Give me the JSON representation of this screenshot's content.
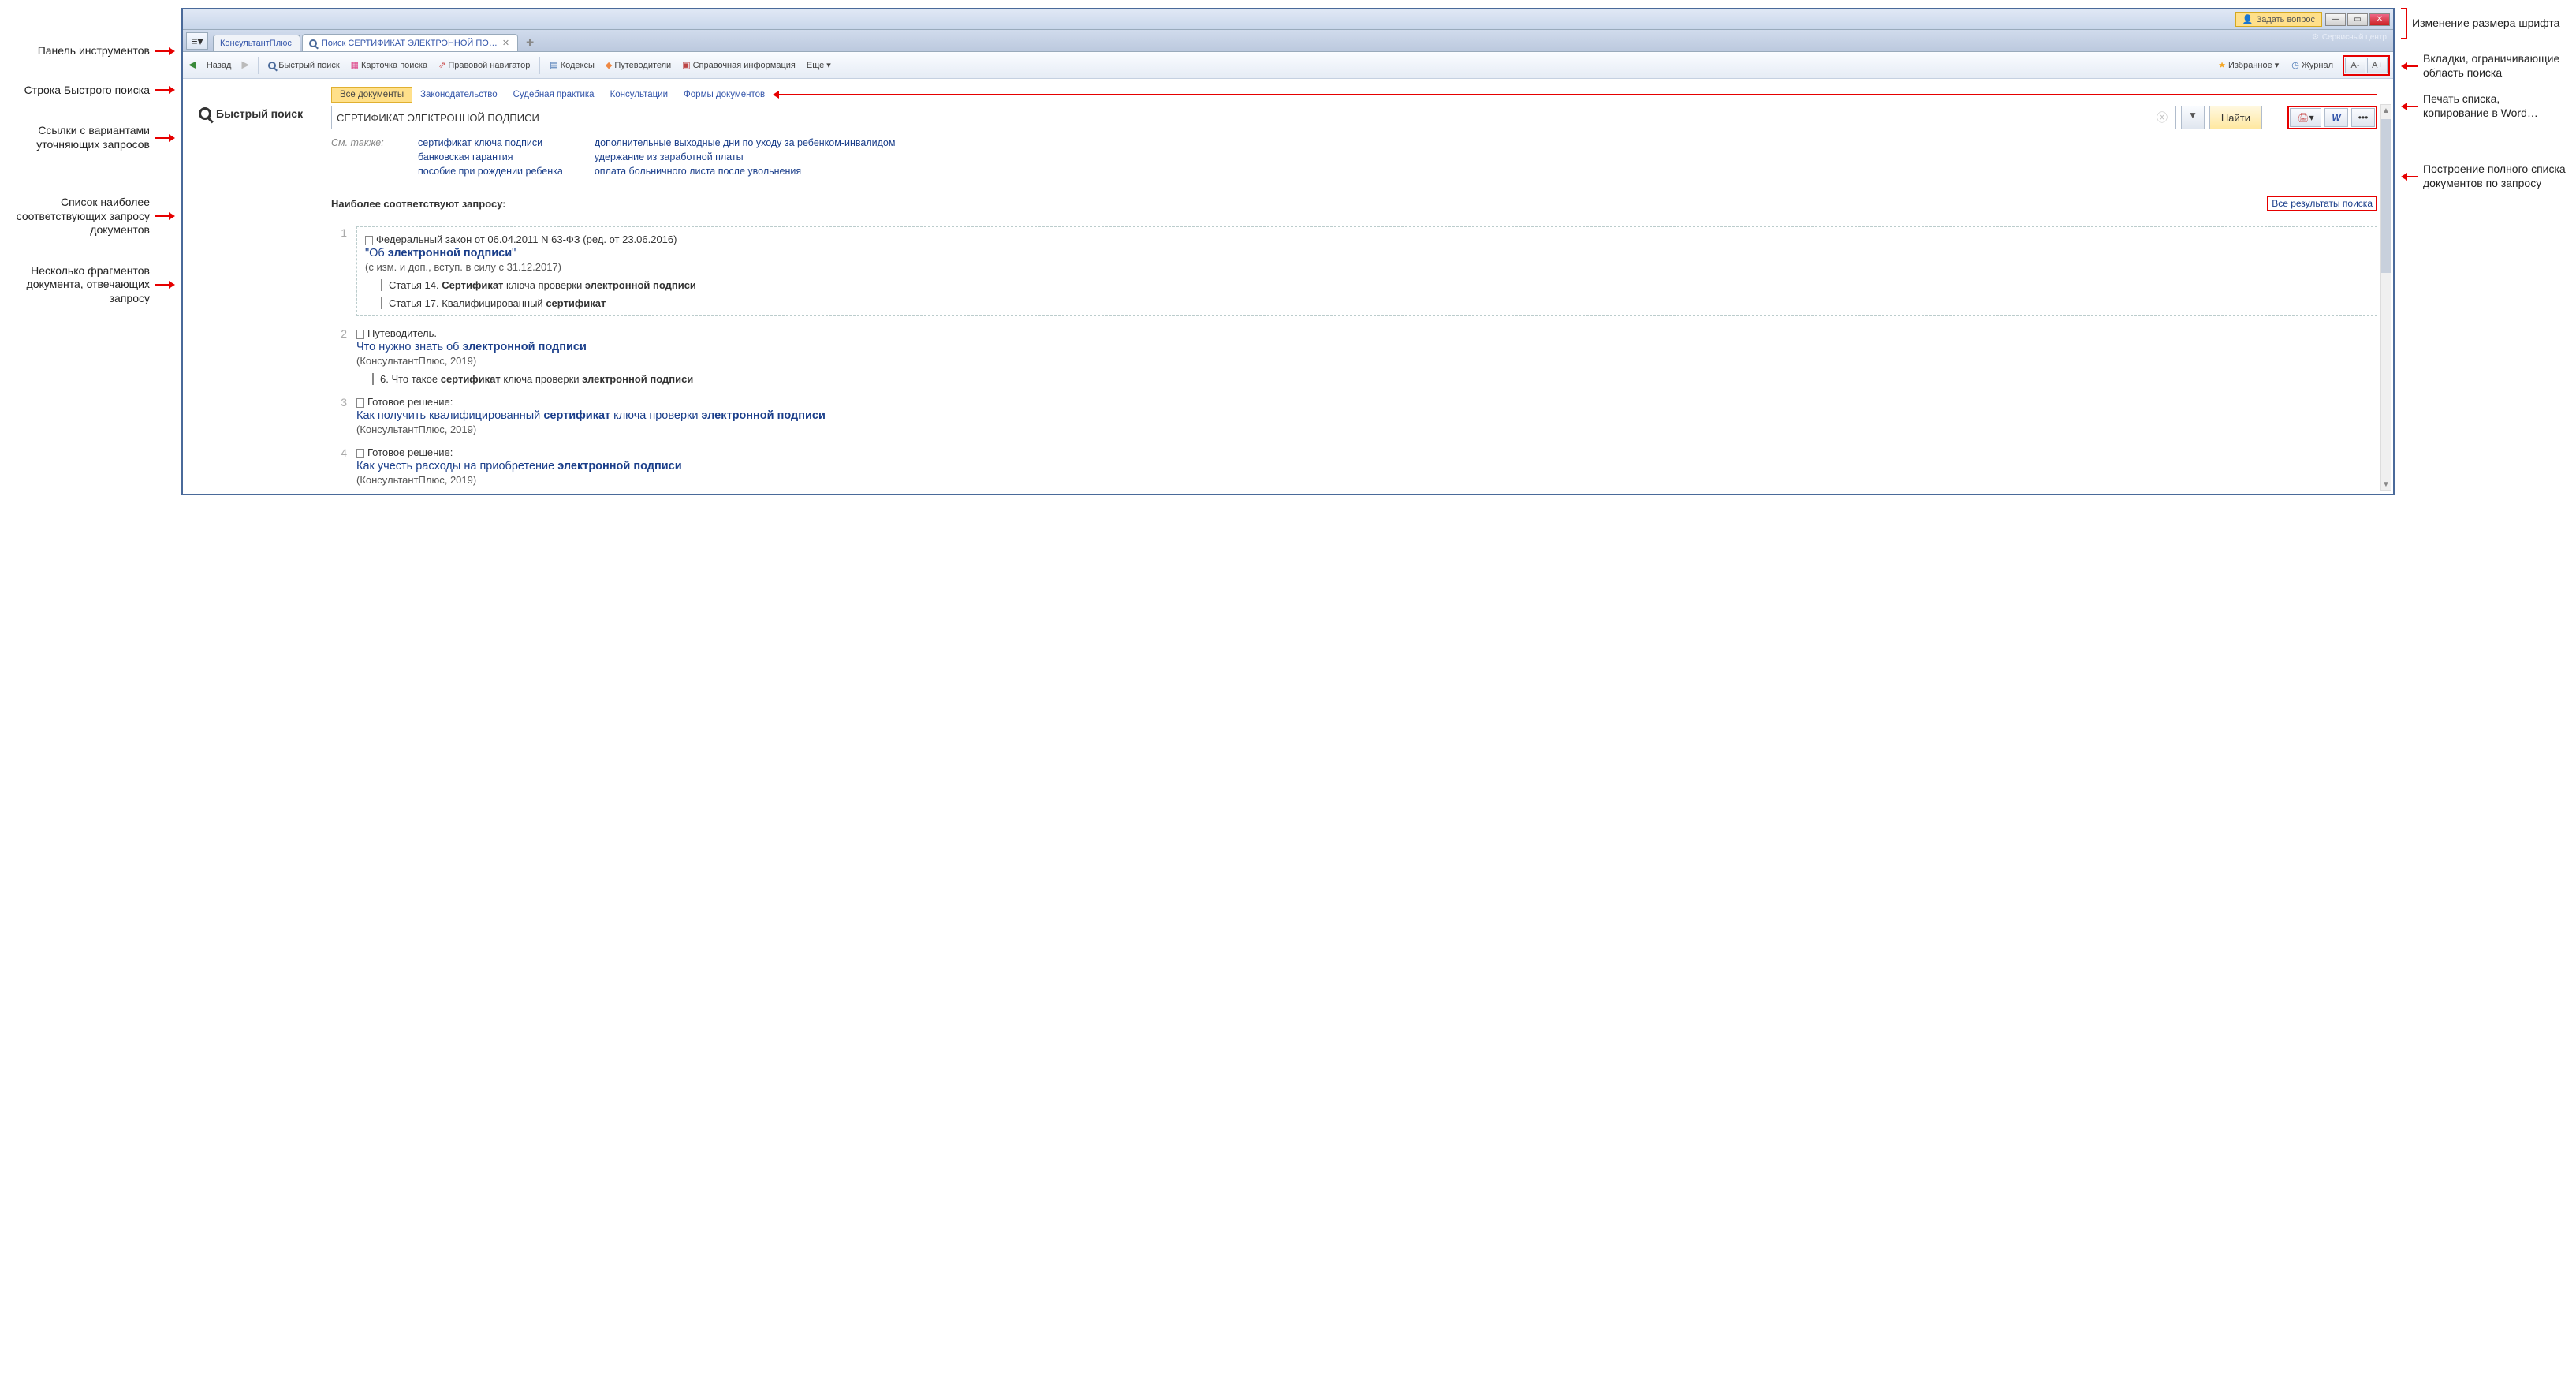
{
  "annotations": {
    "left": {
      "toolbar": "Панель инструментов",
      "quicksearch": "Строка Быстрого поиска",
      "suggestions": "Ссылки с вариантами уточняющих запросов",
      "resultslist": "Список наиболее соответствующих запросу документов",
      "fragments": "Несколько фрагментов документа, отвечающих запросу"
    },
    "right": {
      "fontsize": "Изменение размера шрифта",
      "scopetabs": "Вкладки, ограничивающие область поиска",
      "printcopy": "Печать списка, копирование в Word…",
      "fulllist": "Построение полного списка документов по запросу"
    }
  },
  "titlebar": {
    "ask": "Задать вопрос",
    "service_center": "Сервисный центр"
  },
  "tabs": {
    "home": "КонсультантПлюс",
    "active": "Поиск СЕРТИФИКАТ ЭЛЕКТРОННОЙ ПО…"
  },
  "toolbar": {
    "back": "Назад",
    "quicksearch": "Быстрый поиск",
    "card": "Карточка поиска",
    "navigator": "Правовой навигатор",
    "codex": "Кодексы",
    "guides": "Путеводители",
    "reference": "Справочная информация",
    "more": "Еще",
    "favorites": "Избранное",
    "journal": "Журнал",
    "font_minus": "A-",
    "font_plus": "A+"
  },
  "quicksearch": {
    "label": "Быстрый поиск",
    "value": "СЕРТИФИКАТ ЭЛЕКТРОННОЙ ПОДПИСИ",
    "find": "Найти"
  },
  "filters": {
    "all": "Все документы",
    "law": "Законодательство",
    "court": "Судебная практика",
    "consult": "Консультации",
    "forms": "Формы документов"
  },
  "see_also": {
    "label": "См. также:",
    "col1": {
      "a": "сертификат ключа подписи",
      "b": "банковская гарантия",
      "c": "пособие при рождении ребенка"
    },
    "col2": {
      "a": "дополнительные выходные дни по уходу за ребенком-инвалидом",
      "b": "удержание из заработной платы",
      "c": "оплата больничного листа после увольнения"
    }
  },
  "results": {
    "title": "Наиболее соответствуют запросу:",
    "all_link": "Все результаты поиска",
    "items": {
      "1": {
        "meta": "Федеральный закон от 06.04.2011 N 63-ФЗ (ред. от 23.06.2016)",
        "title_pre": "\"Об ",
        "title_hl": "электронной подписи",
        "title_post": "\"",
        "sub": "(с изм. и доп., вступ. в силу с 31.12.2017)",
        "frag1_pre": "Статья 14. ",
        "frag1_hl1": "Сертификат",
        "frag1_mid": " ключа проверки ",
        "frag1_hl2": "электронной подписи",
        "frag2_pre": "Статья 17. Квалифицированный ",
        "frag2_hl": "сертификат"
      },
      "2": {
        "meta": "Путеводитель.",
        "title_pre": "Что нужно знать об ",
        "title_hl": "электронной подписи",
        "sub": "(КонсультантПлюс, 2019)",
        "frag_pre": "6. Что такое ",
        "frag_hl1": "сертификат",
        "frag_mid": " ключа проверки ",
        "frag_hl2": "электронной подписи"
      },
      "3": {
        "meta": "Готовое решение:",
        "title_pre": "Как получить квалифицированный ",
        "title_hl1": "сертификат",
        "title_mid": " ключа проверки ",
        "title_hl2": "электронной подписи",
        "sub": "(КонсультантПлюс, 2019)"
      },
      "4": {
        "meta": "Готовое решение:",
        "title_pre": "Как учесть расходы на приобретение ",
        "title_hl": "электронной подписи",
        "sub": "(КонсультантПлюс, 2019)"
      }
    }
  },
  "action_icons": {
    "print": "🖨",
    "word": "W",
    "more": "•••"
  }
}
